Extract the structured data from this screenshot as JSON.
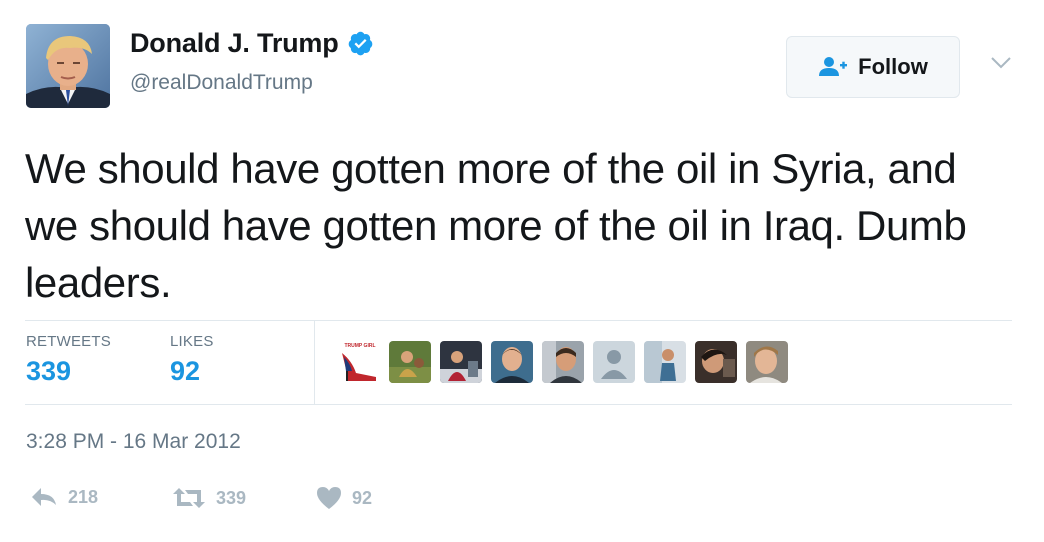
{
  "author": {
    "name": "Donald J. Trump",
    "handle": "@realDonaldTrump",
    "verified": true
  },
  "follow_button": {
    "label": "Follow"
  },
  "tweet": {
    "text": "We should have gotten more of the oil in Syria, and we should have gotten more of the oil in Iraq. Dumb leaders.",
    "timestamp": "3:28 PM - 16 Mar 2012"
  },
  "stats": {
    "retweets_label": "RETWEETS",
    "retweets_count": "339",
    "likes_label": "LIKES",
    "likes_count": "92"
  },
  "likers": [
    {
      "name": "liker-avatar-1"
    },
    {
      "name": "liker-avatar-2"
    },
    {
      "name": "liker-avatar-3"
    },
    {
      "name": "liker-avatar-4"
    },
    {
      "name": "liker-avatar-5"
    },
    {
      "name": "liker-avatar-6"
    },
    {
      "name": "liker-avatar-7"
    },
    {
      "name": "liker-avatar-8"
    },
    {
      "name": "liker-avatar-9"
    }
  ],
  "liker_avatar_text": "TRUMP GIRL",
  "actions": {
    "reply_count": "218",
    "retweet_count": "339",
    "like_count": "92"
  },
  "colors": {
    "accent": "#1b95e0",
    "muted": "#657786",
    "action_icon": "#aab8c2",
    "divider": "#e1e8ed"
  },
  "icons": {
    "verified": "verified-badge-icon",
    "follow": "person-plus-icon",
    "caret": "chevron-down-icon",
    "reply": "reply-arrow-icon",
    "retweet": "retweet-icon",
    "like": "heart-icon"
  }
}
